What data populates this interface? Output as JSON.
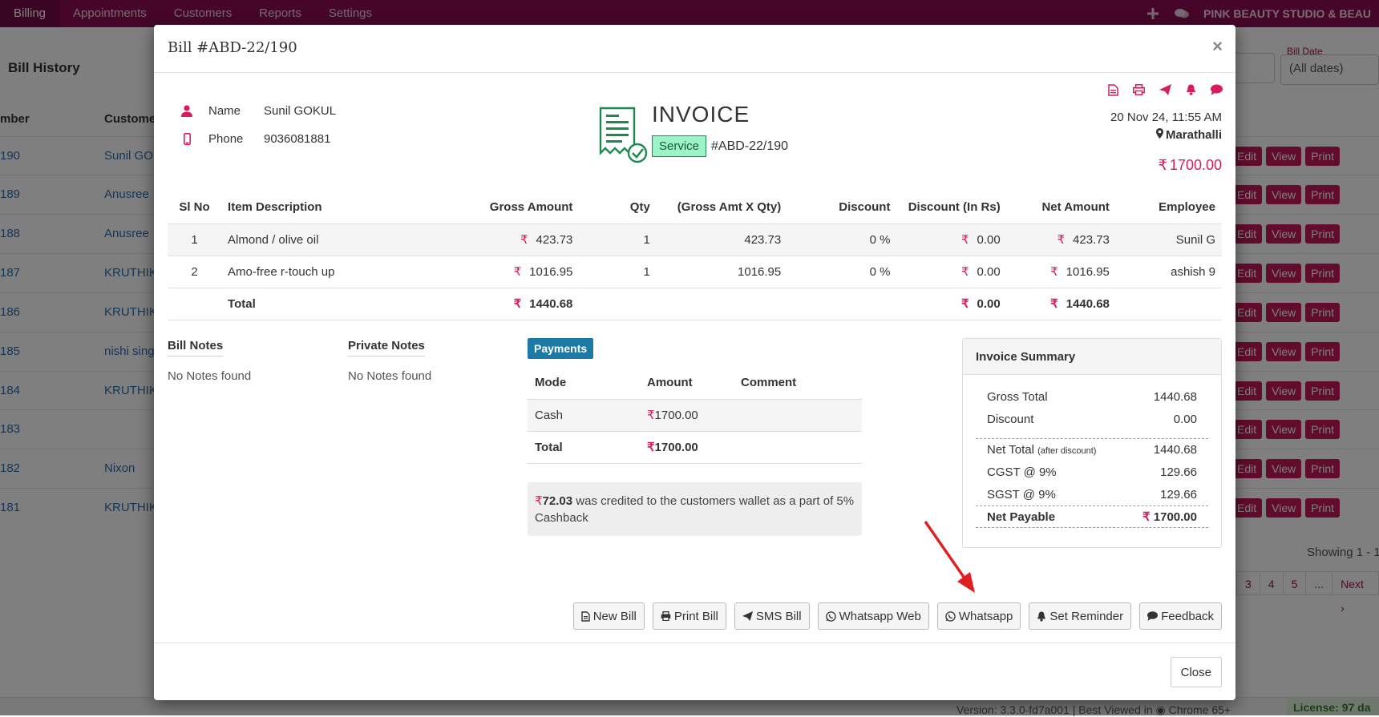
{
  "nav": {
    "items": [
      "Billing",
      "Appointments",
      "Customers",
      "Reports",
      "Settings"
    ],
    "brand": "PINK BEAUTY STUDIO & BEAU"
  },
  "background": {
    "title": "Bill History",
    "col_number": "mber",
    "col_customer": "Custome",
    "rows": [
      {
        "num": "190",
        "name": "Sunil GO"
      },
      {
        "num": "189",
        "name": "Anusree"
      },
      {
        "num": "188",
        "name": "Anusree"
      },
      {
        "num": "187",
        "name": "KRUTHIK"
      },
      {
        "num": "186",
        "name": "KRUTHIK"
      },
      {
        "num": "185",
        "name": "nishi sing"
      },
      {
        "num": "184",
        "name": "KRUTHIK"
      },
      {
        "num": "183",
        "name": ""
      },
      {
        "num": "182",
        "name": "Nixon"
      },
      {
        "num": "181",
        "name": "KRUTHIK"
      }
    ],
    "edit_label": "Edit",
    "view_label": "View",
    "print_label": "Print",
    "bill_date_label": "Bill Date",
    "bill_date_value": "(All dates)",
    "showing": "Showing 1 - 1",
    "pager": [
      "3",
      "4",
      "5",
      "...",
      "Next ›"
    ],
    "version": "Version: 3.3.0-fd7a001 | Best Viewed in",
    "browser": "Chrome 65+",
    "license": "License: 97 da"
  },
  "modal": {
    "title": "Bill #ABD-22/190",
    "customer": {
      "name_label": "Name",
      "name": "Sunil GOKUL",
      "phone_label": "Phone",
      "phone": "9036081881"
    },
    "invoice": {
      "heading": "INVOICE",
      "badge": "Service",
      "number": "#ABD-22/190",
      "date": "20 Nov 24, 11:55 AM",
      "location": "Marathalli",
      "total": "1700.00"
    },
    "items": {
      "headers": [
        "Sl No",
        "Item Description",
        "Gross Amount",
        "Qty",
        "(Gross Amt X Qty)",
        "Discount",
        "Discount (In Rs)",
        "Net Amount",
        "Employee"
      ],
      "rows": [
        {
          "sl": "1",
          "desc": "Almond / olive oil",
          "gross": "423.73",
          "qty": "1",
          "gxq": "423.73",
          "disc": "0 %",
          "disc_rs": "0.00",
          "net": "423.73",
          "emp": "Sunil G"
        },
        {
          "sl": "2",
          "desc": "Amo-free r-touch up",
          "gross": "1016.95",
          "qty": "1",
          "gxq": "1016.95",
          "disc": "0 %",
          "disc_rs": "0.00",
          "net": "1016.95",
          "emp": "ashish 9"
        }
      ],
      "total_label": "Total",
      "total_gross": "1440.68",
      "total_disc_rs": "0.00",
      "total_net": "1440.68"
    },
    "notes": {
      "bill_label": "Bill Notes",
      "bill_value": "No Notes found",
      "private_label": "Private Notes",
      "private_value": "No Notes found"
    },
    "payments": {
      "badge": "Payments",
      "headers": [
        "Mode",
        "Amount",
        "Comment"
      ],
      "rows": [
        {
          "mode": "Cash",
          "amount": "1700.00",
          "comment": ""
        }
      ],
      "total_label": "Total",
      "total_amount": "1700.00"
    },
    "cashback": {
      "amount": "72.03",
      "text": "was credited to the customers wallet as a part of 5% Cashback"
    },
    "summary": {
      "title": "Invoice Summary",
      "gross_label": "Gross Total",
      "gross": "1440.68",
      "discount_label": "Discount",
      "discount": "0.00",
      "net_label": "Net Total",
      "net_sub": "(after discount)",
      "net": "1440.68",
      "cgst_label": "CGST @ 9%",
      "cgst": "129.66",
      "sgst_label": "SGST @ 9%",
      "sgst": "129.66",
      "payable_label": "Net Payable",
      "payable": "1700.00"
    },
    "actions": {
      "new_bill": "New Bill",
      "print_bill": "Print Bill",
      "sms_bill": "SMS Bill",
      "whatsapp_web": "Whatsapp Web",
      "whatsapp": "Whatsapp",
      "set_reminder": "Set Reminder",
      "feedback": "Feedback"
    },
    "close_label": "Close"
  },
  "colors": {
    "nav": "#8c0d52",
    "accent": "#d81b60",
    "payments_badge": "#1d7aa5",
    "service_badge": "#9bf3c7",
    "annotation_arrow": "#e02020"
  }
}
